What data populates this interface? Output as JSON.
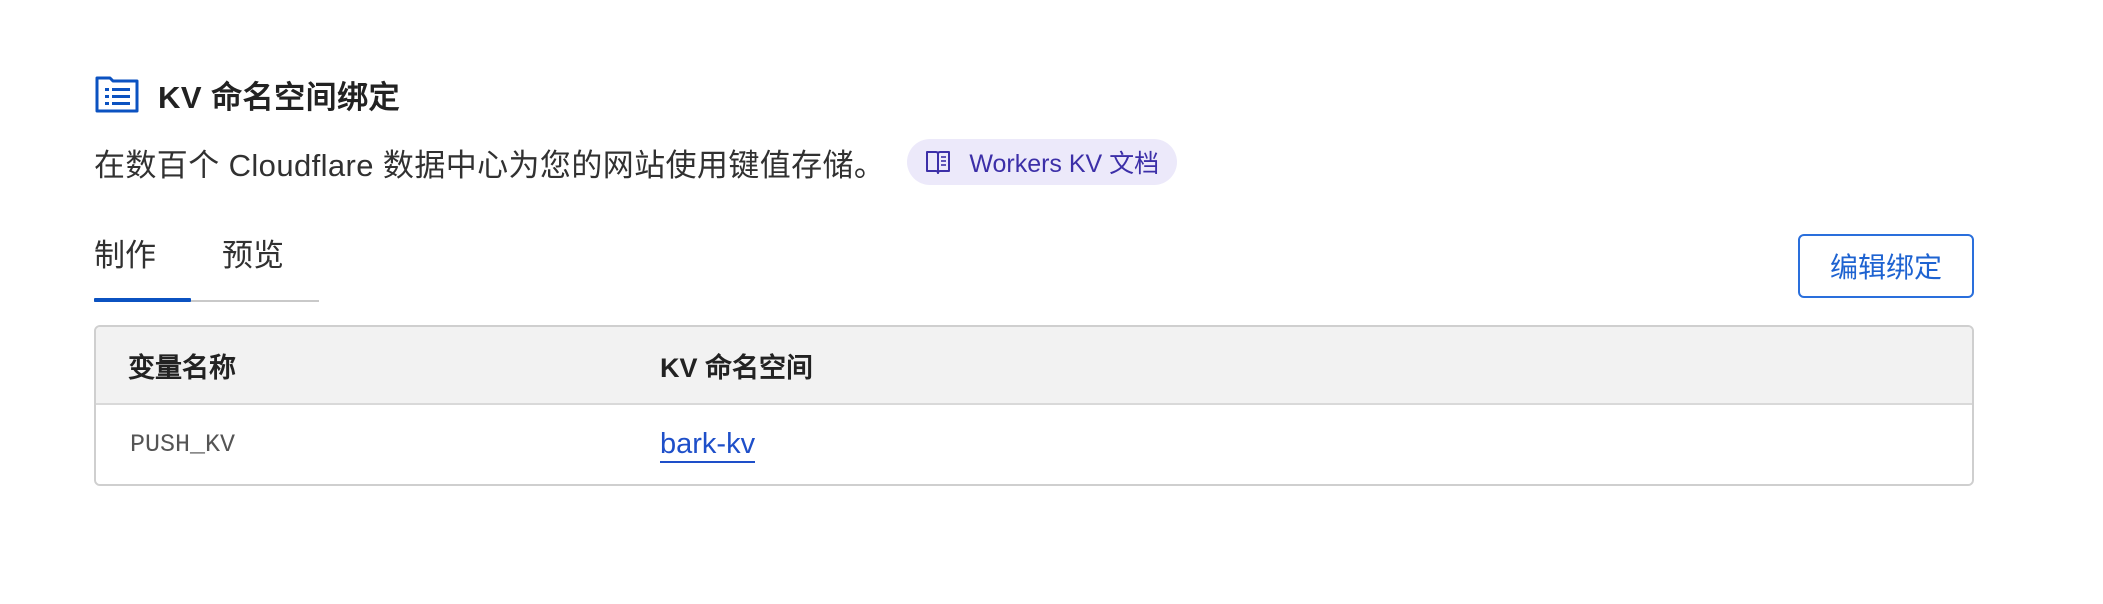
{
  "header": {
    "icon": "list-document-icon",
    "title": "KV 命名空间绑定"
  },
  "description": {
    "text": "在数百个 Cloudflare 数据中心为您的网站使用键值存储。",
    "docs_link": {
      "icon": "book-icon",
      "label": "Workers KV 文档"
    }
  },
  "tabs": [
    {
      "label": "制作",
      "active": true
    },
    {
      "label": "预览",
      "active": false
    }
  ],
  "actions": {
    "edit_bindings_label": "编辑绑定"
  },
  "table": {
    "columns": [
      "变量名称",
      "KV 命名空间"
    ],
    "rows": [
      {
        "variable": "PUSH_KV",
        "namespace": "bark-kv"
      }
    ]
  },
  "colors": {
    "accent": "#0b52c1",
    "link": "#1e4fc9",
    "pill_bg": "#ece9fa",
    "pill_text": "#3c2fa8"
  }
}
